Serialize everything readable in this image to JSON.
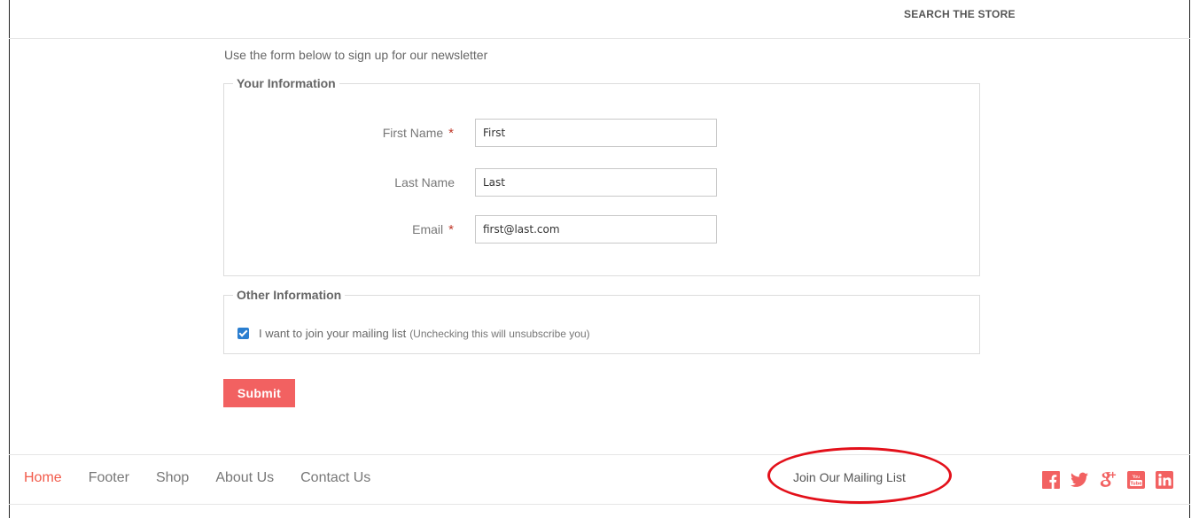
{
  "header": {
    "search_label": "SEARCH THE STORE"
  },
  "form": {
    "intro": "Use the form below to sign up for our newsletter",
    "your_info": {
      "legend": "Your Information",
      "first_name": {
        "label": "First Name",
        "required_mark": "*",
        "value": "First"
      },
      "last_name": {
        "label": "Last Name",
        "value": "Last"
      },
      "email": {
        "label": "Email",
        "required_mark": "*",
        "value": "first@last.com"
      }
    },
    "other_info": {
      "legend": "Other Information",
      "mailing_checkbox": {
        "checked": true,
        "label": "I want to join your mailing list",
        "note": "(Unchecking this will unsubscribe you)"
      }
    },
    "submit_label": "Submit"
  },
  "footer": {
    "nav": [
      {
        "label": "Home",
        "active": true
      },
      {
        "label": "Footer",
        "active": false
      },
      {
        "label": "Shop",
        "active": false
      },
      {
        "label": "About Us",
        "active": false
      },
      {
        "label": "Contact Us",
        "active": false
      }
    ],
    "mailing_link": "Join Our Mailing List",
    "social_icons": [
      "facebook-icon",
      "twitter-icon",
      "google-plus-icon",
      "youtube-icon",
      "linkedin-icon"
    ]
  },
  "colors": {
    "accent": "#f26161",
    "active_nav": "#f25a4a",
    "social": "#f26161",
    "checkbox": "#2a7ed0",
    "annotation": "#e3101a"
  }
}
